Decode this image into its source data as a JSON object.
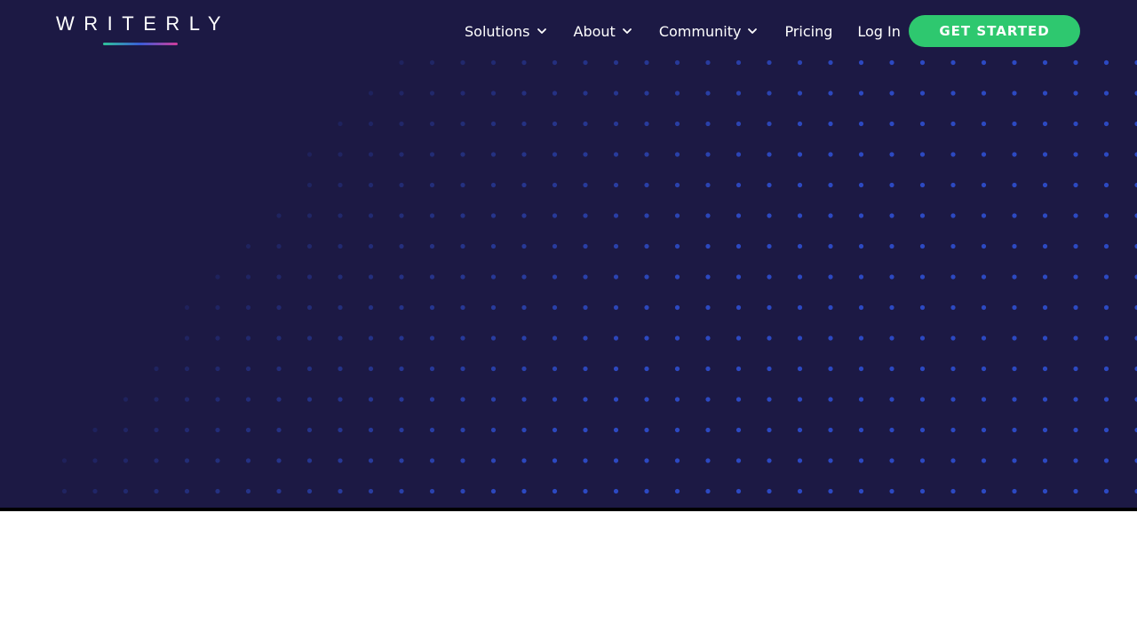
{
  "brand": {
    "name": "WRITERLY",
    "gradient_colors": [
      "#2fc39a",
      "#3a5bd6",
      "#d03c9b"
    ]
  },
  "nav": {
    "items": [
      {
        "label": "Solutions",
        "has_dropdown": true,
        "icon": "chevron-down-icon"
      },
      {
        "label": "About",
        "has_dropdown": true,
        "icon": "chevron-down-icon"
      },
      {
        "label": "Community",
        "has_dropdown": true,
        "icon": "chevron-down-icon"
      },
      {
        "label": "Pricing",
        "has_dropdown": false
      },
      {
        "label": "Log In",
        "has_dropdown": false
      }
    ],
    "cta_label": "GET STARTED"
  },
  "colors": {
    "hero_background": "#1c1944",
    "dot_color": "#2f4fd0",
    "cta_background": "#2ec86f",
    "text": "#ffffff"
  }
}
